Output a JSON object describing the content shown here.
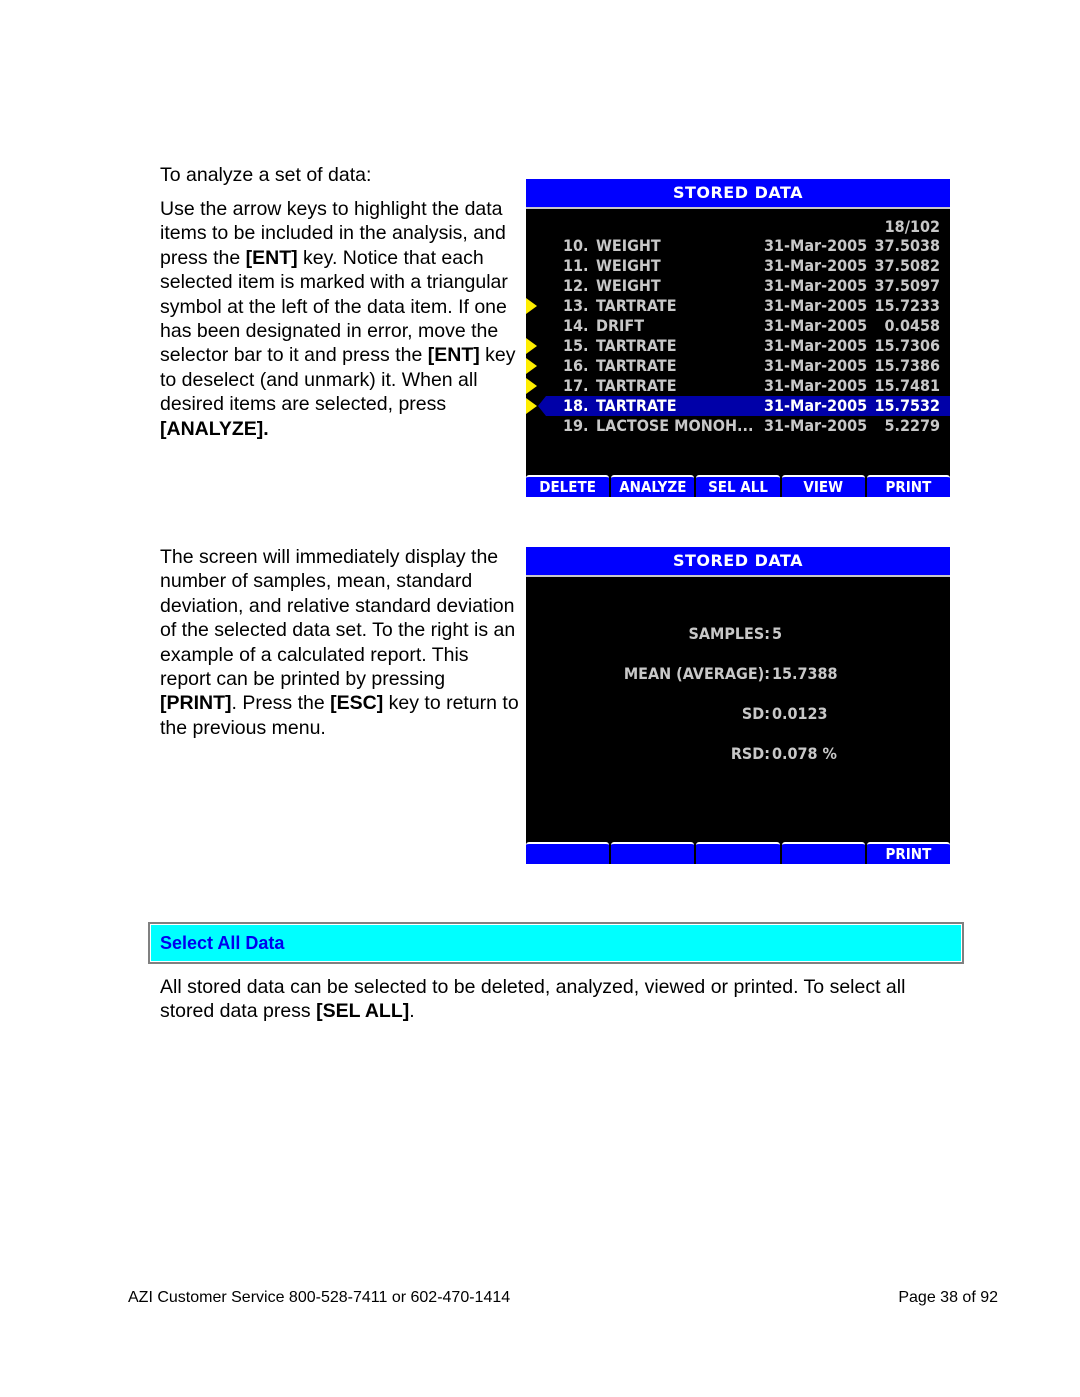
{
  "intro": {
    "title": "To analyze a set of data:",
    "body_parts": [
      {
        "text": "Use the arrow keys to highlight the data items to be included in the analysis, and press the ",
        "bold": false
      },
      {
        "text": "[ENT]",
        "bold": true
      },
      {
        "text": " key. Notice that each selected item is marked with a triangular symbol at the left of the data item.  If one has been designated in error, move the selector bar to it and press the ",
        "bold": false
      },
      {
        "text": "[ENT]",
        "bold": true
      },
      {
        "text": " key to deselect (and unmark) it.  When all desired items are selected, press ",
        "bold": false
      },
      {
        "text": "[ANALYZE].",
        "bold": true
      }
    ]
  },
  "report_text": {
    "body_parts": [
      {
        "text": "The screen will immediately display the number of samples, mean, standard deviation, and relative standard deviation of the selected data set.  To the right is an example of a calculated report.  This report can be printed by pressing ",
        "bold": false
      },
      {
        "text": "[PRINT]",
        "bold": true
      },
      {
        "text": ". Press the ",
        "bold": false
      },
      {
        "text": "[ESC]",
        "bold": true
      },
      {
        "text": " key to return to the previous menu.",
        "bold": false
      }
    ]
  },
  "screen_list": {
    "title": "STORED DATA",
    "counter": "18/102",
    "rows": [
      {
        "num": "10.",
        "name": "WEIGHT",
        "date": "31-Mar-2005",
        "value": "37.5038",
        "marked": false,
        "selected": false
      },
      {
        "num": "11.",
        "name": "WEIGHT",
        "date": "31-Mar-2005",
        "value": "37.5082",
        "marked": false,
        "selected": false
      },
      {
        "num": "12.",
        "name": "WEIGHT",
        "date": "31-Mar-2005",
        "value": "37.5097",
        "marked": false,
        "selected": false
      },
      {
        "num": "13.",
        "name": "TARTRATE",
        "date": "31-Mar-2005",
        "value": "15.7233",
        "marked": true,
        "selected": false
      },
      {
        "num": "14.",
        "name": "DRIFT",
        "date": "31-Mar-2005",
        "value": "0.0458",
        "marked": false,
        "selected": false
      },
      {
        "num": "15.",
        "name": "TARTRATE",
        "date": "31-Mar-2005",
        "value": "15.7306",
        "marked": true,
        "selected": false
      },
      {
        "num": "16.",
        "name": "TARTRATE",
        "date": "31-Mar-2005",
        "value": "15.7386",
        "marked": true,
        "selected": false
      },
      {
        "num": "17.",
        "name": "TARTRATE",
        "date": "31-Mar-2005",
        "value": "15.7481",
        "marked": true,
        "selected": false
      },
      {
        "num": "18.",
        "name": "TARTRATE",
        "date": "31-Mar-2005",
        "value": "15.7532",
        "marked": true,
        "selected": true
      },
      {
        "num": "19.",
        "name": "LACTOSE MONOH...",
        "date": "31-Mar-2005",
        "value": "5.2279",
        "marked": false,
        "selected": false
      }
    ],
    "softkeys": [
      "DELETE",
      "ANALYZE",
      "SEL ALL",
      "VIEW",
      "PRINT"
    ]
  },
  "screen_report": {
    "title": "STORED DATA",
    "stats": [
      {
        "label": "SAMPLES:",
        "value": "5"
      },
      {
        "label": "MEAN (AVERAGE):",
        "value": "15.7388"
      },
      {
        "label": "SD:",
        "value": "0.0123"
      },
      {
        "label": "RSD:",
        "value": "0.078 %"
      }
    ],
    "softkeys": [
      "",
      "",
      "",
      "",
      "PRINT"
    ]
  },
  "section": {
    "header": "Select All Data",
    "body_parts": [
      {
        "text": "All stored data can be selected to be deleted, analyzed, viewed or printed.  To select all stored data press ",
        "bold": false
      },
      {
        "text": "[SEL ALL]",
        "bold": true
      },
      {
        "text": ".",
        "bold": false
      }
    ]
  },
  "footer": {
    "left": "AZI Customer Service 800-528-7411 or 602-470-1414",
    "right": "Page 38 of 92"
  },
  "colors": {
    "screen_title_bg": "#0000ff",
    "selected_bar": "#0000a8",
    "marker": "#ffee00",
    "section_header_bg": "#00ffff",
    "section_header_text": "#0000ee"
  }
}
